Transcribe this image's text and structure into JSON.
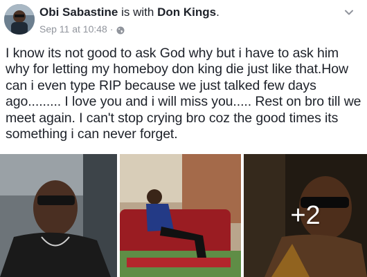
{
  "post": {
    "author": "Obi Sabastine",
    "with_text": " is with ",
    "tagged": "Don Kings",
    "tagged_suffix": ".",
    "timestamp": "Sep 11 at 10:48",
    "meta_separator": "·",
    "privacy_icon": "globe-icon",
    "menu_icon": "chevron-down-icon",
    "body": "I know its not good to ask God why but i have to ask him why for letting my homeboy don king die just like that.How can i even type RIP because we just talked few days ago......... I love you and i will miss you..... Rest on bro till we meet again. I can't stop crying bro coz the good times its something i can never forget.",
    "photos": {
      "more_count": "+2"
    }
  },
  "colors": {
    "text": "#1d2129",
    "meta": "#90949c",
    "background": "#ffffff"
  }
}
